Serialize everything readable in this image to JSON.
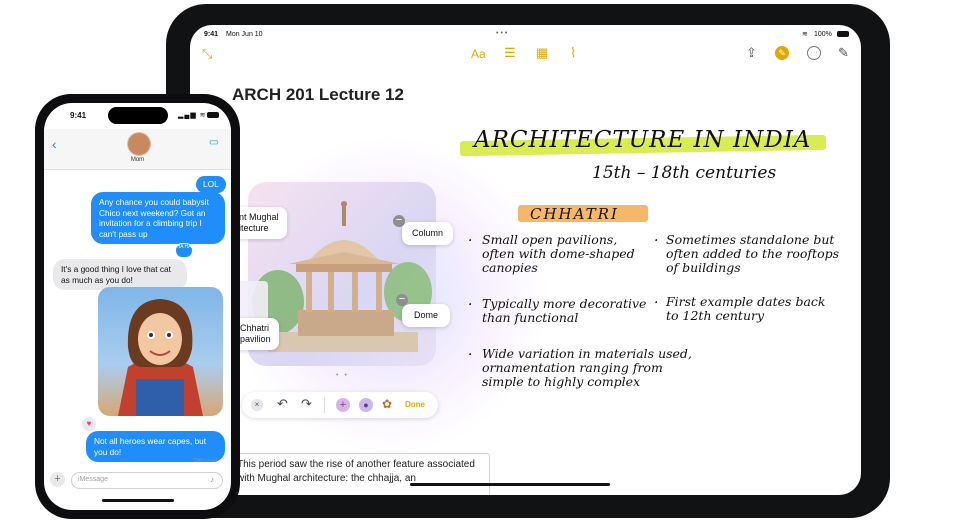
{
  "ipad": {
    "status": {
      "time": "9:41",
      "date": "Mon Jun 10",
      "battery": "100%"
    },
    "toolbar_icons": [
      "collapse-icon",
      "text-format-icon",
      "checklist-icon",
      "table-icon",
      "attachment-icon",
      "share-icon",
      "markup-icon",
      "more-icon",
      "compose-icon"
    ],
    "toolbar": {
      "text_format": "Aa"
    },
    "note_title": "ARCH 201 Lecture 12",
    "image_labels": {
      "mughal": "ent Mughal\nhitecture",
      "column": "Column",
      "dome": "Dome",
      "chhatri": "Chhatri\npavilion"
    },
    "image_toolbar": {
      "done": "Done"
    },
    "handwriting": {
      "title": "ARCHITECTURE IN INDIA",
      "subtitle": "15th – 18th centuries",
      "heading": "CHHATRI",
      "bullets_left": [
        "Small open pavilions, often with dome-shaped canopies",
        "Typically more decorative than functional",
        "Wide variation in materials used, ornamentation ranging from simple to highly complex"
      ],
      "bullets_right": [
        "Sometimes standalone but often added to the rooftops of buildings",
        "First example dates back to 12th century"
      ]
    },
    "body_text": "This period saw the rise of another feature associated with Mughal architecture: the chhajja, an",
    "colors": {
      "accent": "#e2a800",
      "highlight_green": "#d9ec52",
      "highlight_orange": "#f5b76a"
    }
  },
  "iphone": {
    "status": {
      "time": "9:41"
    },
    "contact": {
      "name": "Mom"
    },
    "messages": [
      {
        "from": "me",
        "text": "LOL"
      },
      {
        "from": "me",
        "text": "Any chance you could babysit Chico next weekend? Got an invitation for a climbing trip I can't pass up"
      },
      {
        "from": "them",
        "text": "It's a good thing I love that cat as much as you do!"
      },
      {
        "from": "me",
        "text": "Not all heroes wear capes, but you do!"
      }
    ],
    "tapback": "HA HA",
    "delivered": "Delivered",
    "input_placeholder": "iMessage",
    "colors": {
      "bubble_blue": "#1f8efa",
      "bubble_gray": "#e9e9eb"
    }
  }
}
